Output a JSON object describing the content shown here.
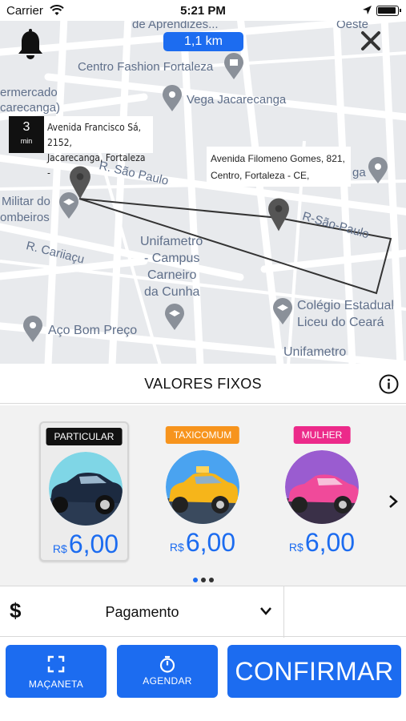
{
  "status_bar": {
    "carrier": "Carrier",
    "time": "5:21 PM"
  },
  "map": {
    "distance": "1,1 km",
    "eta": {
      "value": "3",
      "unit": "min"
    },
    "origin_address": [
      "Avenida Francisco Sá, 2152,",
      "Jacarecanga, Fortaleza -"
    ],
    "destination_address": [
      "Avenida Filomeno Gomes, 821,",
      "Centro, Fortaleza - CE,"
    ],
    "labels": [
      "de Aprendizes...",
      "Oeste",
      "Centro Fashion Fortaleza",
      "ermercado",
      "carecanga)",
      "Vega Jacarecanga",
      "R. São Paulo",
      "ga",
      "Militar do",
      "ombeiros",
      "R-São-Paulo",
      "R. Cariiaçu",
      "Unifametro",
      "- Campus",
      "Carneiro",
      "da Cunha",
      "Colégio Estadual",
      "Liceu do Ceará",
      "Aço Bom Preço",
      "Unifametro"
    ],
    "route_color": "#333333"
  },
  "sheet": {
    "title": "VALORES FIXOS",
    "cards": [
      {
        "tag": "PARTICULAR",
        "tag_color": "#111111",
        "currency": "R$",
        "price": "6,00",
        "selected": true,
        "car": "sedan-dark"
      },
      {
        "tag": "TAXICOMUM",
        "tag_color": "#f7941d",
        "currency": "R$",
        "price": "6,00",
        "selected": false,
        "car": "taxi-yellow"
      },
      {
        "tag": "MULHER",
        "tag_color": "#ec2a8a",
        "currency": "R$",
        "price": "6,00",
        "selected": false,
        "car": "car-pink"
      }
    ],
    "pagination": {
      "pages": 3,
      "active": 0
    },
    "payment": {
      "symbol": "$",
      "label": "Pagamento"
    },
    "buttons": {
      "handle_label": "MAÇANETA",
      "schedule_label": "AGENDAR",
      "confirm_label": "CONFIRMAR"
    }
  },
  "colors": {
    "accent": "#1c6cf0"
  }
}
